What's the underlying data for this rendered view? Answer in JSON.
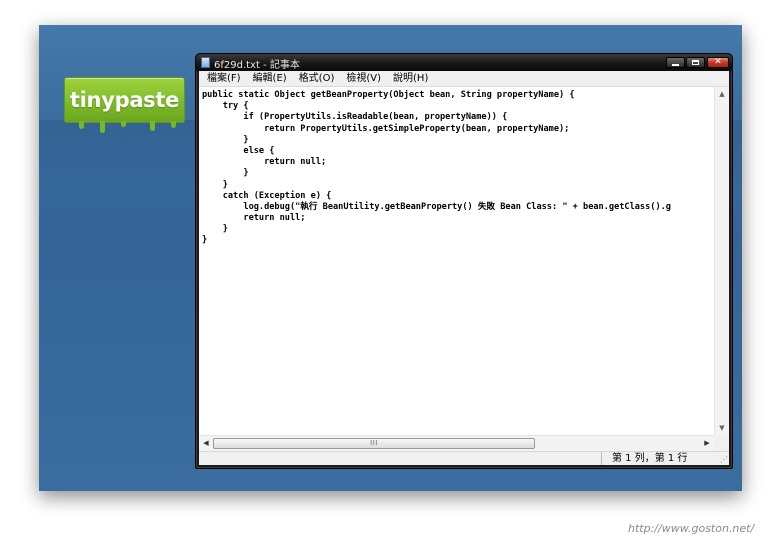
{
  "brand": {
    "logo_text": "tinypaste",
    "logo_color": "#8cc63f",
    "desktop_color": "#3a6d9f"
  },
  "window": {
    "title": "6f29d.txt - 記事本",
    "icon": "notepad-icon",
    "buttons": {
      "minimize": "minimize-icon",
      "maximize": "maximize-icon",
      "close": "close-icon"
    }
  },
  "menu": {
    "items": [
      {
        "label": "檔案(F)"
      },
      {
        "label": "編輯(E)"
      },
      {
        "label": "格式(O)"
      },
      {
        "label": "檢視(V)"
      },
      {
        "label": "說明(H)"
      }
    ]
  },
  "editor": {
    "lines": [
      "public static Object getBeanProperty(Object bean, String propertyName) {",
      "    try {",
      "        if (PropertyUtils.isReadable(bean, propertyName)) {",
      "            return PropertyUtils.getSimpleProperty(bean, propertyName);",
      "        }",
      "        else {",
      "            return null;",
      "        }",
      "    }",
      "    catch (Exception e) {",
      "        log.debug(\"執行 BeanUtility.getBeanProperty() 失敗 Bean Class: \" + bean.getClass().g",
      "        return null;",
      "    }",
      "}"
    ]
  },
  "scrollbars": {
    "grip": "III"
  },
  "status": {
    "position": "第 1 列，第 1 行"
  },
  "watermark": "http://www.goston.net/"
}
